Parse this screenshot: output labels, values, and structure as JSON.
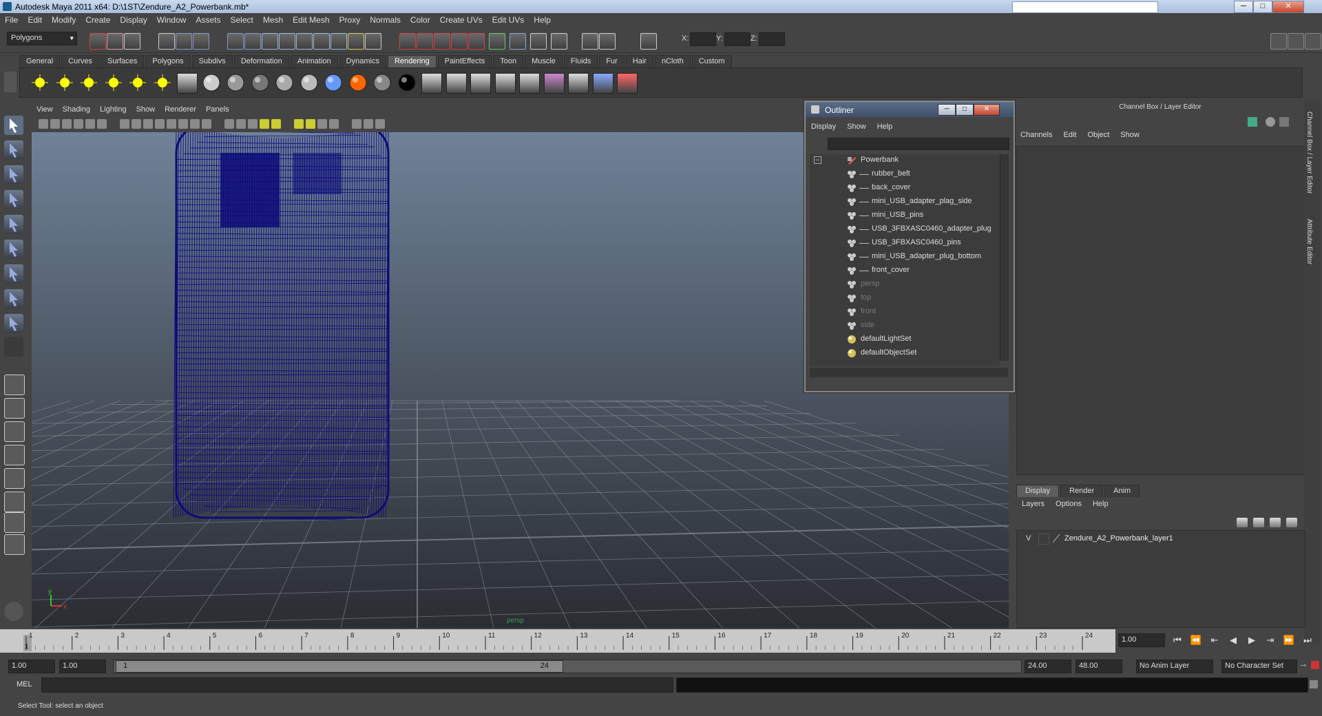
{
  "window": {
    "title": "Autodesk Maya 2011 x64: D:\\1ST\\Zendure_A2_Powerbank.mb*",
    "minimize": "─",
    "maximize": "□",
    "close": "✕"
  },
  "menus": [
    "File",
    "Edit",
    "Modify",
    "Create",
    "Display",
    "Window",
    "Assets",
    "Select",
    "Mesh",
    "Edit Mesh",
    "Proxy",
    "Normals",
    "Color",
    "Create UVs",
    "Edit UVs",
    "Help"
  ],
  "status_line": {
    "mode": "Polygons",
    "coord_labels": [
      "X:",
      "Y:",
      "Z:"
    ]
  },
  "shelf": {
    "tabs": [
      "General",
      "Curves",
      "Surfaces",
      "Polygons",
      "Subdivs",
      "Deformation",
      "Animation",
      "Dynamics",
      "Rendering",
      "PaintEffects",
      "Toon",
      "Muscle",
      "Fluids",
      "Fur",
      "Hair",
      "nCloth",
      "Custom"
    ],
    "active_tab": "Rendering"
  },
  "viewport": {
    "menu": [
      "View",
      "Shading",
      "Lighting",
      "Show",
      "Renderer",
      "Panels"
    ],
    "camera_label": "persp",
    "axis_x": "x",
    "axis_y": "y",
    "wire_color": "#0d0a7a"
  },
  "outliner": {
    "title": "Outliner",
    "menu": [
      "Display",
      "Show",
      "Help"
    ],
    "items": [
      {
        "label": "Powerbank",
        "indent": 0,
        "kind": "group",
        "dim": false
      },
      {
        "label": "rubber_belt",
        "indent": 1,
        "kind": "mesh",
        "dim": false
      },
      {
        "label": "back_cover",
        "indent": 1,
        "kind": "mesh",
        "dim": false
      },
      {
        "label": "mini_USB_adapter_plag_side",
        "indent": 1,
        "kind": "mesh",
        "dim": false
      },
      {
        "label": "mini_USB_pins",
        "indent": 1,
        "kind": "mesh",
        "dim": false
      },
      {
        "label": "USB_3FBXASC0460_adapter_plug",
        "indent": 1,
        "kind": "mesh",
        "dim": false
      },
      {
        "label": "USB_3FBXASC0460_pins",
        "indent": 1,
        "kind": "mesh",
        "dim": false
      },
      {
        "label": "mini_USB_adapter_plug_bottom",
        "indent": 1,
        "kind": "mesh",
        "dim": false
      },
      {
        "label": "front_cover",
        "indent": 1,
        "kind": "mesh",
        "dim": false
      },
      {
        "label": "persp",
        "indent": 0,
        "kind": "camera",
        "dim": true
      },
      {
        "label": "top",
        "indent": 0,
        "kind": "camera",
        "dim": true
      },
      {
        "label": "front",
        "indent": 0,
        "kind": "camera",
        "dim": true
      },
      {
        "label": "side",
        "indent": 0,
        "kind": "camera",
        "dim": true
      },
      {
        "label": "defaultLightSet",
        "indent": 0,
        "kind": "set",
        "dim": false
      },
      {
        "label": "defaultObjectSet",
        "indent": 0,
        "kind": "set",
        "dim": false
      }
    ]
  },
  "channel_box": {
    "title": "Channel Box / Layer Editor",
    "menu": [
      "Channels",
      "Edit",
      "Object",
      "Show"
    ],
    "side_tabs": [
      "Channel Box / Layer Editor",
      "Attribute Editor"
    ]
  },
  "layer_editor": {
    "tabs": [
      "Display",
      "Render",
      "Anim"
    ],
    "active_tab": "Display",
    "menu": [
      "Layers",
      "Options",
      "Help"
    ],
    "layer": {
      "visible": "V",
      "name": "Zendure_A2_Powerbank_layer1"
    }
  },
  "time_slider": {
    "ticks": [
      "1",
      "2",
      "3",
      "4",
      "5",
      "6",
      "7",
      "8",
      "9",
      "10",
      "11",
      "12",
      "13",
      "14",
      "15",
      "16",
      "17",
      "18",
      "19",
      "20",
      "21",
      "22",
      "23",
      "24"
    ],
    "current": "1",
    "current_field": "1.00"
  },
  "range_slider": {
    "start_time": "1.00",
    "playback_start": "1.00",
    "range_start": "1",
    "range_end": "24",
    "playback_end": "24.00",
    "end_time": "48.00",
    "anim_layer": "No Anim Layer",
    "character_set": "No Character Set"
  },
  "command_line": {
    "label": "MEL"
  },
  "help_line": {
    "text": "Select Tool: select an object"
  }
}
